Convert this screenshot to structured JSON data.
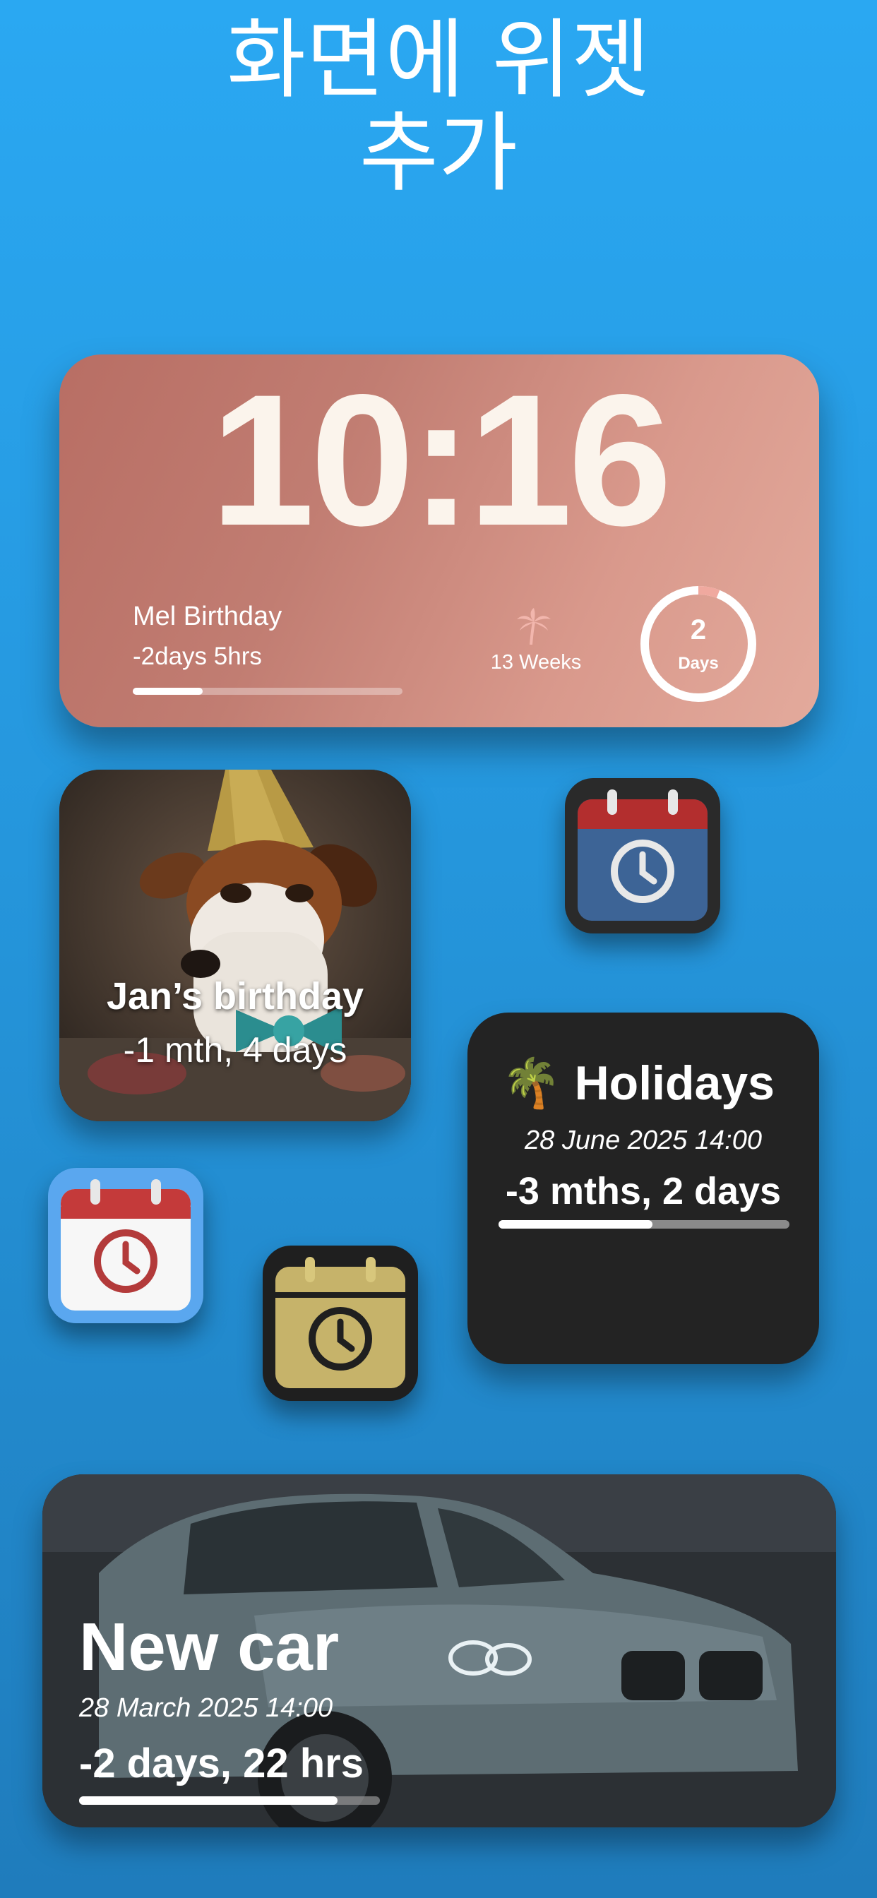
{
  "header": {
    "line1": "화면에 위젯",
    "line2": "추가"
  },
  "lock_widget": {
    "time": "10:16",
    "event_name": "Mel Birthday",
    "event_countdown": "-2days 5hrs",
    "event_progress": 0.26,
    "weeks_icon": "palm-tree-icon",
    "weeks_label": "13 Weeks",
    "ring_value": "2",
    "ring_label": "Days",
    "ring_progress": 0.06,
    "background_color": "#c17d72"
  },
  "dog_widget": {
    "title": "Jan’s birthday",
    "countdown": "-1 mth, 4 days"
  },
  "app_icons": [
    {
      "name": "calendar-clock-dark-blue-icon",
      "color": "#3d6496"
    },
    {
      "name": "calendar-clock-white-icon",
      "color": "#5aa7ef"
    },
    {
      "name": "calendar-clock-gold-icon",
      "color": "#c6b36a"
    }
  ],
  "holidays_widget": {
    "emoji": "🌴",
    "title": "Holidays",
    "date": "28 June 2025 14:00",
    "countdown": "-3 mths, 2 days",
    "progress": 0.53
  },
  "car_widget": {
    "title": "New car",
    "date": "28 March 2025 14:00",
    "countdown": "-2 days, 22 hrs",
    "progress": 0.86
  }
}
